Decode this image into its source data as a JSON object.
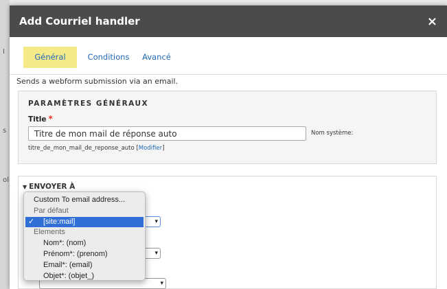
{
  "background": {
    "edge_fragments": [
      "I",
      "s",
      "ol"
    ]
  },
  "dialog": {
    "title": "Add Courriel handler",
    "close_glyph": "×"
  },
  "tabs": [
    {
      "label": "Général",
      "active": true
    },
    {
      "label": "Conditions",
      "active": false
    },
    {
      "label": "Avancé",
      "active": false
    }
  ],
  "description": "Sends a webform submission via an email.",
  "general_settings": {
    "legend": "PARAMÈTRES GÉNÉRAUX",
    "title_label": "Title",
    "required_marker": "*",
    "title_value": "Titre de mon mail de réponse auto",
    "machine_label": "Nom système:",
    "machine_name": "titre_de_mon_mail_de_reponse_auto",
    "modify_link": "Modifier"
  },
  "send_to": {
    "legend": "ENVOYER À",
    "arrow": "▼"
  },
  "dropdown": {
    "check_glyph": "✓",
    "options": [
      {
        "label": "Custom To email address...",
        "kind": "option"
      },
      {
        "label": "Par défaut",
        "kind": "group"
      },
      {
        "label": "[site:mail]",
        "kind": "selected"
      },
      {
        "label": "Elements",
        "kind": "group"
      },
      {
        "label": "Nom*: (nom)",
        "kind": "option"
      },
      {
        "label": "Prénom*: (prenom)",
        "kind": "option"
      },
      {
        "label": "Email*: (email)",
        "kind": "option"
      },
      {
        "label": "Objet*: (objet_)",
        "kind": "option"
      }
    ]
  },
  "colors": {
    "titlebar": "#4b4b4b",
    "active_tab": "#f4ea8a",
    "link": "#1f68b8",
    "selection": "#2f6fd6",
    "required": "#ee3322"
  }
}
